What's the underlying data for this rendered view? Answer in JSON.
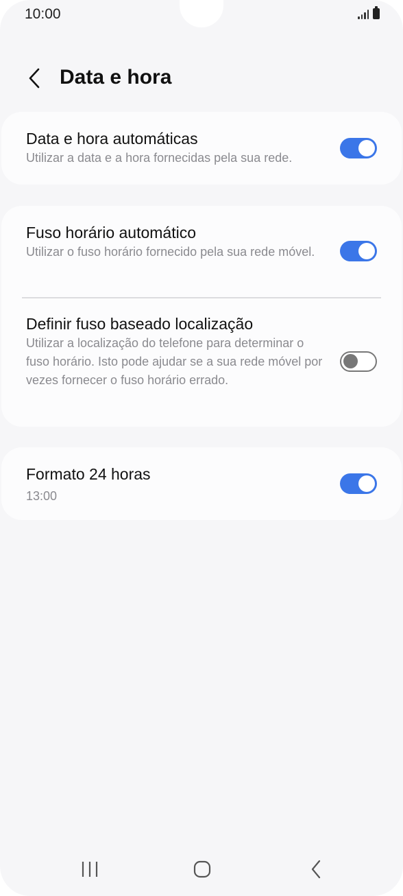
{
  "status_bar": {
    "time": "10:00"
  },
  "header": {
    "title": "Data e hora"
  },
  "settings": {
    "auto_datetime": {
      "title": "Data e hora automáticas",
      "subtitle": "Utilizar a data e a hora fornecidas pela sua rede.",
      "enabled": true
    },
    "auto_timezone": {
      "title": "Fuso horário automático",
      "subtitle": "Utilizar o fuso horário fornecido pela sua rede móvel.",
      "enabled": true
    },
    "location_timezone": {
      "title": "Definir fuso baseado localização",
      "subtitle": "Utilizar a localização do telefone para determinar o fuso horário. Isto pode ajudar se a sua rede móvel por vezes fornecer o fuso horário errado.",
      "enabled": false
    },
    "format_24h": {
      "title": "Formato 24 horas",
      "subtitle": "13:00",
      "enabled": true
    }
  },
  "colors": {
    "accent": "#3b76e8",
    "background": "#f6f6f8",
    "card": "#fcfcfd"
  },
  "icons": {
    "back": "chevron-left-icon",
    "recents": "recents-icon",
    "home": "home-icon",
    "nav_back": "back-icon"
  }
}
